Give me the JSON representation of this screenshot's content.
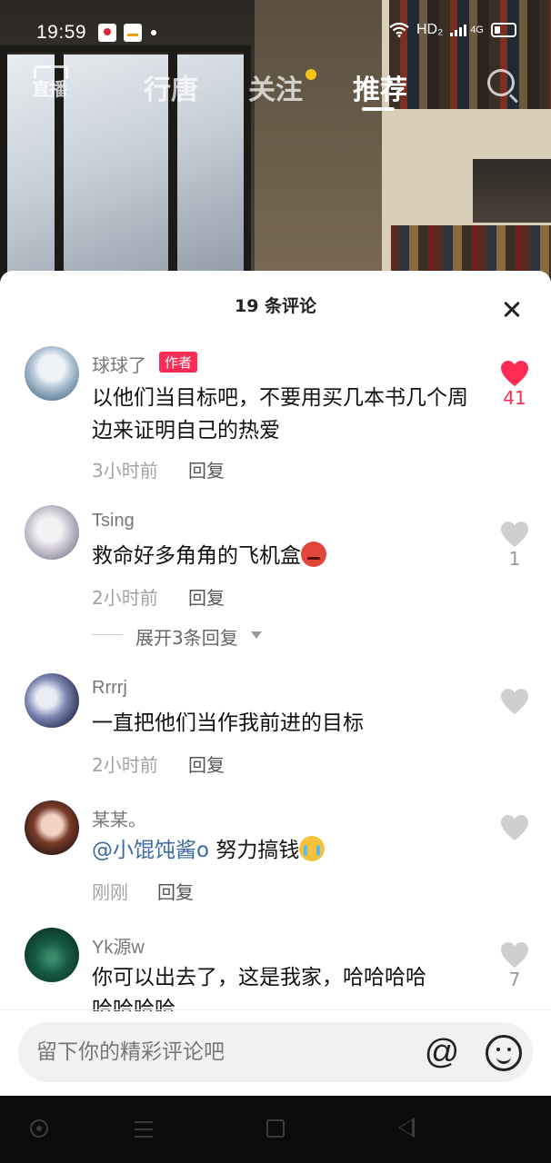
{
  "status_bar": {
    "time": "19:59",
    "network": "HD₂",
    "signal": "4G"
  },
  "top_nav": {
    "live_icon": "直播",
    "tabs": [
      {
        "label": "行唐",
        "active": false
      },
      {
        "label": "关注",
        "active": false,
        "has_dot": true
      },
      {
        "label": "推荐",
        "active": true
      }
    ]
  },
  "comments_panel": {
    "title": "19 条评论",
    "reply_label": "回复",
    "comments": [
      {
        "user": "球球了",
        "author_tag": "作者",
        "text": "以他们当目标吧，不要用买几本书几个周边来证明自己的热爱",
        "time": "3小时前",
        "likes": "41",
        "liked": true
      },
      {
        "user": "Tsing",
        "text": "救命好多角角的飞机盒",
        "time": "2小时前",
        "likes": "1",
        "liked": false,
        "expand_label": "展开3条回复"
      },
      {
        "user": "Rrrrj",
        "text": "一直把他们当作我前进的目标",
        "time": "2小时前",
        "likes": "",
        "liked": false
      },
      {
        "user": "某某。",
        "mention": "@小馄饨酱o",
        "text": " 努力搞钱",
        "time": "刚刚",
        "likes": "",
        "liked": false
      },
      {
        "user": "Yk源w",
        "text": "你可以出去了，这是我家，哈哈哈哈",
        "text_cut": "哈哈哈哈",
        "time": "",
        "likes": "7",
        "liked": false
      }
    ]
  },
  "input": {
    "placeholder": "留下你的精彩评论吧",
    "at_label": "@"
  },
  "colors": {
    "accent": "#fe2c55",
    "mention": "#3d6aa5",
    "muted": "#a3a3a3"
  }
}
